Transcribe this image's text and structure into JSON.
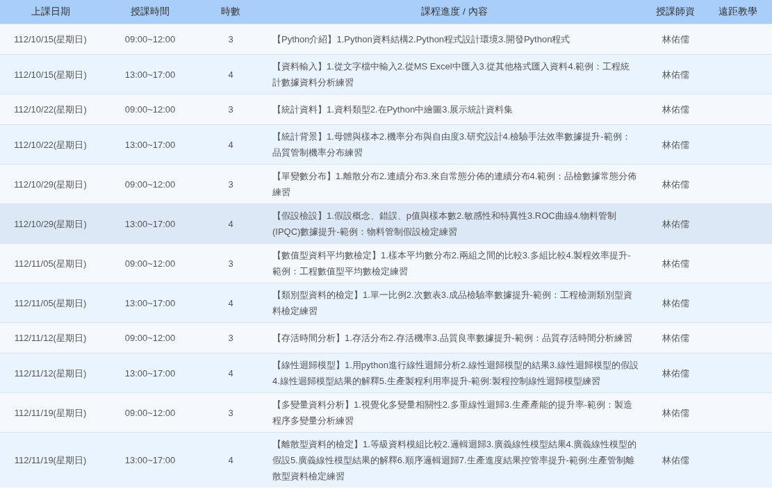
{
  "table": {
    "columns": [
      "上課日期",
      "授課時間",
      "時數",
      "課程進度 / 內容",
      "授課師資",
      "遠距教學"
    ],
    "rows": [
      {
        "date": "112/10/15(星期日)",
        "time": "09:00~12:00",
        "hours": "3",
        "content": "【Python介紹】1.Python資料結構2.Python程式設計環境3.開發Python程式",
        "teacher": "林佑儒",
        "highlighted": false
      },
      {
        "date": "112/10/15(星期日)",
        "time": "13:00~17:00",
        "hours": "4",
        "content": "【資料輸入】1.從文字檔中輸入2.從MS Excel中匯入3.從其他格式匯入資料4.範例：工程統計數據資料分析練習",
        "teacher": "林佑儒",
        "highlighted": false
      },
      {
        "date": "112/10/22(星期日)",
        "time": "09:00~12:00",
        "hours": "3",
        "content": "【統計資料】1.資料類型2.在Python中繪圖3.展示統計資料集",
        "teacher": "林佑儒",
        "highlighted": false
      },
      {
        "date": "112/10/22(星期日)",
        "time": "13:00~17:00",
        "hours": "4",
        "content": "【統計背景】1.母體與樣本2.機率分布與自由度3.研究設計4.檢驗手法效率數據提升-範例：品質管制機率分布練習",
        "teacher": "林佑儒",
        "highlighted": false
      },
      {
        "date": "112/10/29(星期日)",
        "time": "09:00~12:00",
        "hours": "3",
        "content": "【單變數分布】1.離散分布2.連續分布3.來自常態分佈的連續分布4.範例：品檢數據常態分佈練習",
        "teacher": "林佑儒",
        "highlighted": false
      },
      {
        "date": "112/10/29(星期日)",
        "time": "13:00~17:00",
        "hours": "4",
        "content": "【假設檢設】1.假設概念、錯誤、p值與樣本數2.敏感性和特異性3.ROC曲線4.物料管制(IPQC)數據提升-範例：物料管制假設檢定練習",
        "teacher": "林佑儒",
        "highlighted": true
      },
      {
        "date": "112/11/05(星期日)",
        "time": "09:00~12:00",
        "hours": "3",
        "content": "【數值型資料平均數檢定】1.樣本平均數分布2.兩組之間的比較3.多組比較4.製程效率提升-範例：工程數值型平均數檢定練習",
        "teacher": "林佑儒",
        "highlighted": false
      },
      {
        "date": "112/11/05(星期日)",
        "time": "13:00~17:00",
        "hours": "4",
        "content": "【類別型資料的檢定】1.單一比例2.次數表3.成品檢驗率數據提升-範例：工程檢測類別型資料檢定練習",
        "teacher": "林佑儒",
        "highlighted": false
      },
      {
        "date": "112/11/12(星期日)",
        "time": "09:00~12:00",
        "hours": "3",
        "content": "【存活時間分析】1.存活分布2.存活機率3.品質良率數據提升-範例：品質存活時間分析練習",
        "teacher": "林佑儒",
        "highlighted": false
      },
      {
        "date": "112/11/12(星期日)",
        "time": "13:00~17:00",
        "hours": "4",
        "content": "【線性迴歸模型】1.用python進行線性迴歸分析2.線性迴歸模型的結果3.線性迴歸模型的假設4.線性迴歸模型結果的解釋5.生產製程利用率提升-範例:製程控制線性迴歸模型練習",
        "teacher": "林佑儒",
        "highlighted": false
      },
      {
        "date": "112/11/19(星期日)",
        "time": "09:00~12:00",
        "hours": "3",
        "content": "【多變量資料分析】1.視覺化多變量相關性2.多重線性迴歸3.生產產能的提升率-範例：製造程序多變量分析練習",
        "teacher": "林佑儒",
        "highlighted": false
      },
      {
        "date": "112/11/19(星期日)",
        "time": "13:00~17:00",
        "hours": "4",
        "content": "【離散型資料的檢定】1.等級資料模組比較2.邏輯迴歸3.廣義線性模型結果4.廣義線性模型的假設5.廣義線性模型結果的解釋6.順序邏輯迴歸7.生產進度結果控管率提升-範例:生產管制離散型資料檢定練習",
        "teacher": "林佑儒",
        "highlighted": false
      }
    ]
  }
}
